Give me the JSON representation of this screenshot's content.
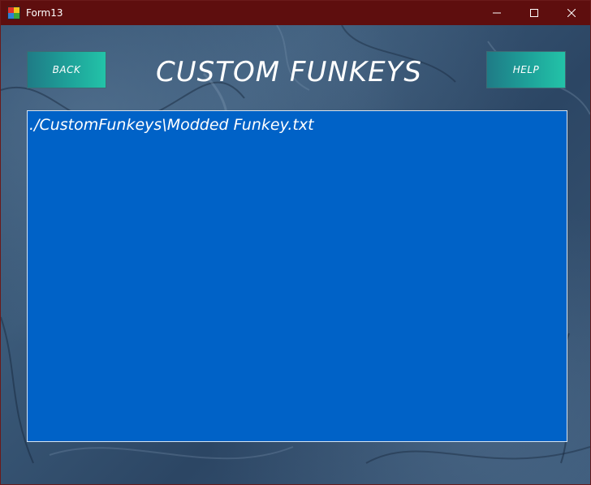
{
  "window": {
    "title": "Form13"
  },
  "toolbar": {
    "back_label": "BACK",
    "help_label": "HELP",
    "heading": "CUSTOM FUNKEYS"
  },
  "list": {
    "items": [
      "./CustomFunkeys\\Modded Funkey.txt"
    ]
  },
  "colors": {
    "titlebar": "#5e0e0e",
    "listbox": "#0062c7",
    "button": "#1ea39a"
  },
  "icons": {
    "app": "winforms-app-icon",
    "minimize": "minimize-icon",
    "maximize": "maximize-icon",
    "close": "close-icon"
  }
}
